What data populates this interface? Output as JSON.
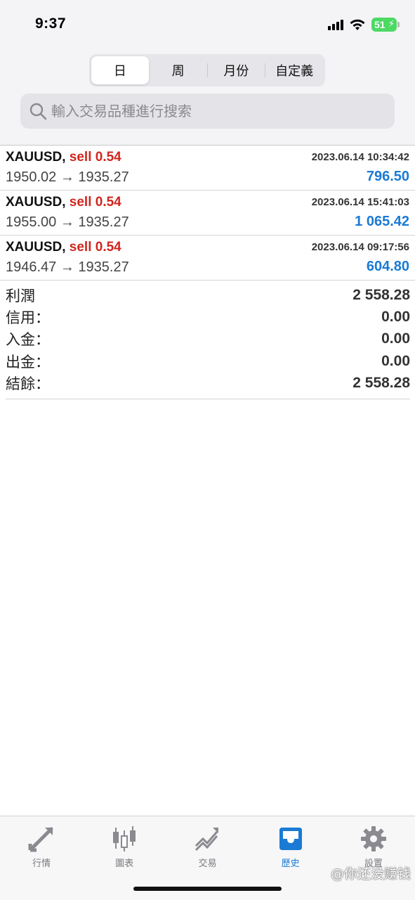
{
  "status_bar": {
    "time": "9:37",
    "battery": "51"
  },
  "segments": [
    {
      "label": "日",
      "active": true
    },
    {
      "label": "周",
      "active": false
    },
    {
      "label": "月份",
      "active": false
    },
    {
      "label": "自定義",
      "active": false
    }
  ],
  "search": {
    "placeholder": "輸入交易品種進行搜索"
  },
  "trades": [
    {
      "symbol": "XAUUSD,",
      "side": "sell 0.54",
      "time": "2023.06.14 10:34:42",
      "prices": "1950.02 → 1935.27",
      "profit": "796.50"
    },
    {
      "symbol": "XAUUSD,",
      "side": "sell 0.54",
      "time": "2023.06.14 15:41:03",
      "prices": "1955.00 → 1935.27",
      "profit": "1 065.42"
    },
    {
      "symbol": "XAUUSD,",
      "side": "sell 0.54",
      "time": "2023.06.14 09:17:56",
      "prices": "1946.47 → 1935.27",
      "profit": "604.80"
    }
  ],
  "summary": [
    {
      "label": "利潤",
      "value": "2 558.28"
    },
    {
      "label": "信用：",
      "value": "0.00"
    },
    {
      "label": "入金：",
      "value": "0.00"
    },
    {
      "label": "出金：",
      "value": "0.00"
    },
    {
      "label": "結餘：",
      "value": "2 558.28"
    }
  ],
  "tabs": [
    {
      "label": "行情",
      "icon": "arrows-icon",
      "active": false
    },
    {
      "label": "圖表",
      "icon": "candlestick-icon",
      "active": false
    },
    {
      "label": "交易",
      "icon": "trend-icon",
      "active": false
    },
    {
      "label": "歷史",
      "icon": "inbox-icon",
      "active": true
    },
    {
      "label": "設置",
      "icon": "gear-icon",
      "active": false
    }
  ],
  "watermark": "@你还没赚钱",
  "colors": {
    "accent": "#1a7ad4",
    "sell": "#d0261e",
    "battery": "#4cd964"
  }
}
